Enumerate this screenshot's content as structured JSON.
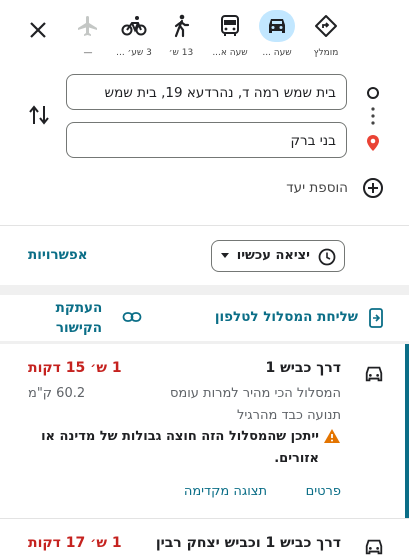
{
  "modes": [
    {
      "name": "best",
      "label": "מומלץ",
      "selected": false
    },
    {
      "name": "drive",
      "label": "שעה ...",
      "selected": true
    },
    {
      "name": "transit",
      "label": "שעה א...",
      "selected": false
    },
    {
      "name": "walk",
      "label": "13 ש׳",
      "selected": false
    },
    {
      "name": "bike",
      "label": "3 שע׳ ...",
      "selected": false
    },
    {
      "name": "flight",
      "label": "—",
      "selected": false
    }
  ],
  "origin_value": "בית שמש רמה ד, נהרדעא 19, בית שמש",
  "destination_value": "בני ברק",
  "add_destination": "הוספת יעד",
  "depart_now": "יציאה עכשיו",
  "options": "אפשרויות",
  "send_to_phone": "שליחת המסלול לטלפון",
  "copy_link": "העתקת הקישור",
  "routes": [
    {
      "title": "דרך כביש 1",
      "time": "1 ש׳ 15 דקות",
      "desc": "המסלול הכי מהיר למרות עומס",
      "distance": "60.2 ק\"מ",
      "traffic": "תנועה כבד מהרגיל",
      "warning": "ייתכן שהמסלול הזה חוצה גבולות של מדינה או אזורים.",
      "details": "פרטים",
      "preview": "תצוגה מקדימה"
    },
    {
      "title": "דרך כביש 1 וכביש יצחק רבין",
      "time": "1 ש׳ 17 דקות"
    }
  ],
  "colors": {
    "accent": "#0b6e87",
    "selected_mode": "#c2e7ff",
    "time_red": "#c5221f",
    "route_bar": "#0b6e87"
  }
}
